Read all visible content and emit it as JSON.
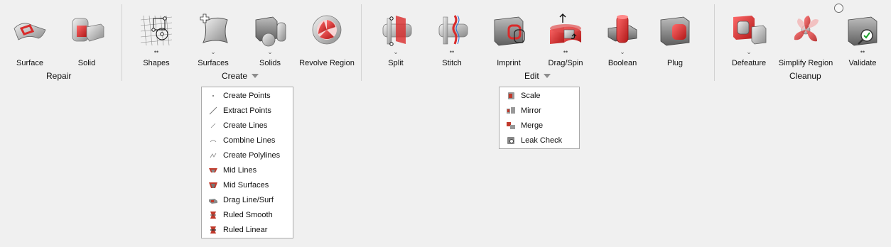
{
  "ribbon": {
    "groups": [
      {
        "label": "Repair",
        "has_dropdown": false
      },
      {
        "label": "Create",
        "has_dropdown": true
      },
      {
        "label": "Edit",
        "has_dropdown": true
      },
      {
        "label": "Cleanup",
        "has_dropdown": false
      }
    ],
    "tools": [
      {
        "label": "Surface",
        "icon": "surface-repair-icon",
        "marker": ""
      },
      {
        "label": "Solid",
        "icon": "solid-repair-icon",
        "marker": ""
      },
      {
        "label": "Shapes",
        "icon": "shapes-icon",
        "marker": "••"
      },
      {
        "label": "Surfaces",
        "icon": "surfaces-icon",
        "marker": "⌄"
      },
      {
        "label": "Solids",
        "icon": "solids-icon",
        "marker": "⌄"
      },
      {
        "label": "Revolve Region",
        "icon": "revolve-region-icon",
        "marker": ""
      },
      {
        "label": "Split",
        "icon": "split-icon",
        "marker": "⌄"
      },
      {
        "label": "Stitch",
        "icon": "stitch-icon",
        "marker": "••"
      },
      {
        "label": "Imprint",
        "icon": "imprint-icon",
        "marker": ""
      },
      {
        "label": "Drag/Spin",
        "icon": "drag-spin-icon",
        "marker": "••"
      },
      {
        "label": "Boolean",
        "icon": "boolean-icon",
        "marker": "⌄"
      },
      {
        "label": "Plug",
        "icon": "plug-icon",
        "marker": ""
      },
      {
        "label": "Defeature",
        "icon": "defeature-icon",
        "marker": "⌄"
      },
      {
        "label": "Simplify Region",
        "icon": "simplify-region-icon",
        "marker": ""
      },
      {
        "label": "Validate",
        "icon": "validate-icon",
        "marker": "••"
      }
    ]
  },
  "create_menu": {
    "items": [
      {
        "label": "Create Points",
        "icon": "point-icon"
      },
      {
        "label": "Extract Points",
        "icon": "extract-points-icon"
      },
      {
        "label": "Create Lines",
        "icon": "line-icon"
      },
      {
        "label": "Combine Lines",
        "icon": "combine-lines-icon"
      },
      {
        "label": "Create Polylines",
        "icon": "polyline-icon"
      },
      {
        "label": "Mid Lines",
        "icon": "mid-lines-icon"
      },
      {
        "label": "Mid Surfaces",
        "icon": "mid-surfaces-icon"
      },
      {
        "label": "Drag Line/Surf",
        "icon": "drag-line-surf-icon"
      },
      {
        "label": "Ruled Smooth",
        "icon": "ruled-smooth-icon"
      },
      {
        "label": "Ruled Linear",
        "icon": "ruled-linear-icon"
      }
    ]
  },
  "edit_menu": {
    "items": [
      {
        "label": "Scale",
        "icon": "scale-icon"
      },
      {
        "label": "Mirror",
        "icon": "mirror-icon"
      },
      {
        "label": "Merge",
        "icon": "merge-icon"
      },
      {
        "label": "Leak Check",
        "icon": "leak-check-icon"
      }
    ]
  },
  "colors": {
    "accent_red": "#d92b2b",
    "gray": "#9a9a9a",
    "background": "#f0f0f0"
  }
}
